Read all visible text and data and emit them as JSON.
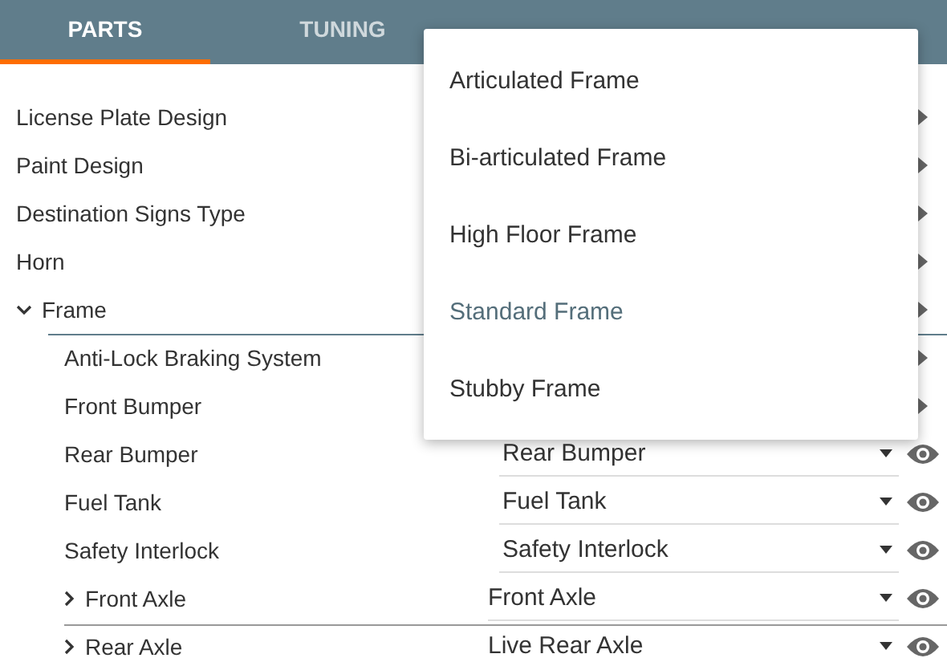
{
  "tabs": [
    {
      "label": "PARTS",
      "selected": true
    },
    {
      "label": "TUNING",
      "selected": false
    }
  ],
  "parts": [
    {
      "name": "License Plate Design",
      "kind": "link"
    },
    {
      "name": "Paint Design",
      "kind": "link"
    },
    {
      "name": "Destination Signs Type",
      "kind": "link"
    },
    {
      "name": "Horn",
      "kind": "link"
    },
    {
      "name": "Frame",
      "kind": "link",
      "expanded": true,
      "children": [
        {
          "name": "Anti-Lock Braking System",
          "kind": "link"
        },
        {
          "name": "Front Bumper",
          "kind": "link"
        },
        {
          "name": "Rear Bumper",
          "kind": "select",
          "value": "Rear Bumper"
        },
        {
          "name": "Fuel Tank",
          "kind": "select",
          "value": "Fuel Tank"
        },
        {
          "name": "Safety Interlock",
          "kind": "select",
          "value": "Safety Interlock"
        },
        {
          "name": "Front Axle",
          "kind": "select",
          "value": "Front Axle",
          "expanded": false
        },
        {
          "name": "Rear Axle",
          "kind": "select",
          "value": "Live Rear Axle",
          "expanded": false
        }
      ]
    }
  ],
  "menu": {
    "items": [
      {
        "label": "Articulated Frame",
        "selected": false
      },
      {
        "label": "Bi-articulated Frame",
        "selected": false
      },
      {
        "label": "High Floor Frame",
        "selected": false
      },
      {
        "label": "Standard Frame",
        "selected": true
      },
      {
        "label": "Stubby Frame",
        "selected": false
      }
    ]
  }
}
